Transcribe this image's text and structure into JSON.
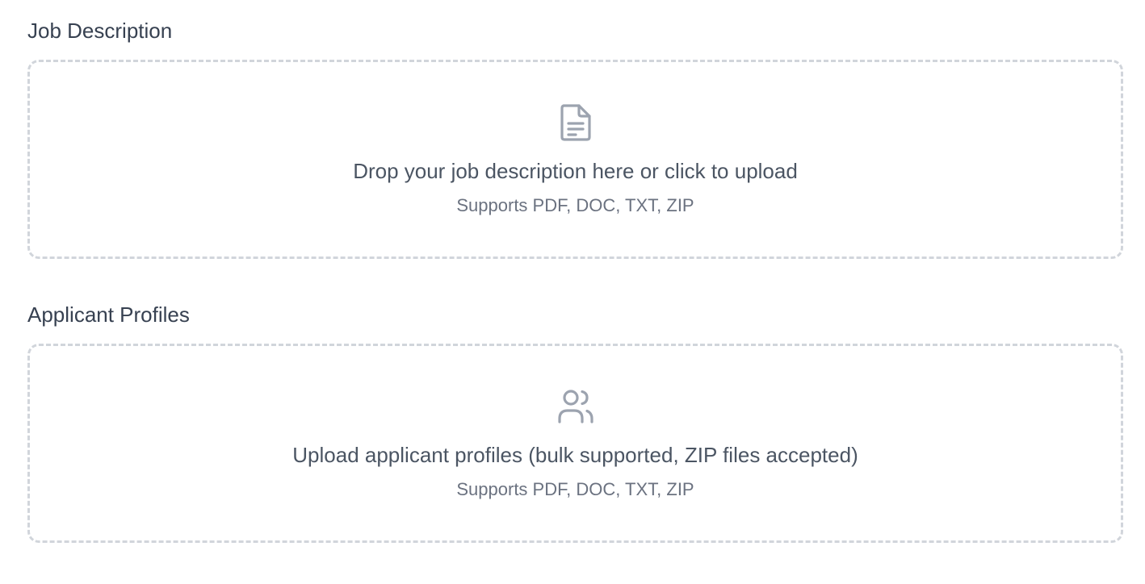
{
  "job_description": {
    "title": "Job Description",
    "icon": "file-text-icon",
    "prompt": "Drop your job description here or click to upload",
    "supports": "Supports PDF, DOC, TXT, ZIP"
  },
  "applicant_profiles": {
    "title": "Applicant Profiles",
    "icon": "users-icon",
    "prompt": "Upload applicant profiles (bulk supported, ZIP files accepted)",
    "supports": "Supports PDF, DOC, TXT, ZIP"
  },
  "colors": {
    "heading": "#374151",
    "text": "#4b5563",
    "muted": "#6b7280",
    "icon": "#9ca3af",
    "border": "#d1d5db"
  }
}
